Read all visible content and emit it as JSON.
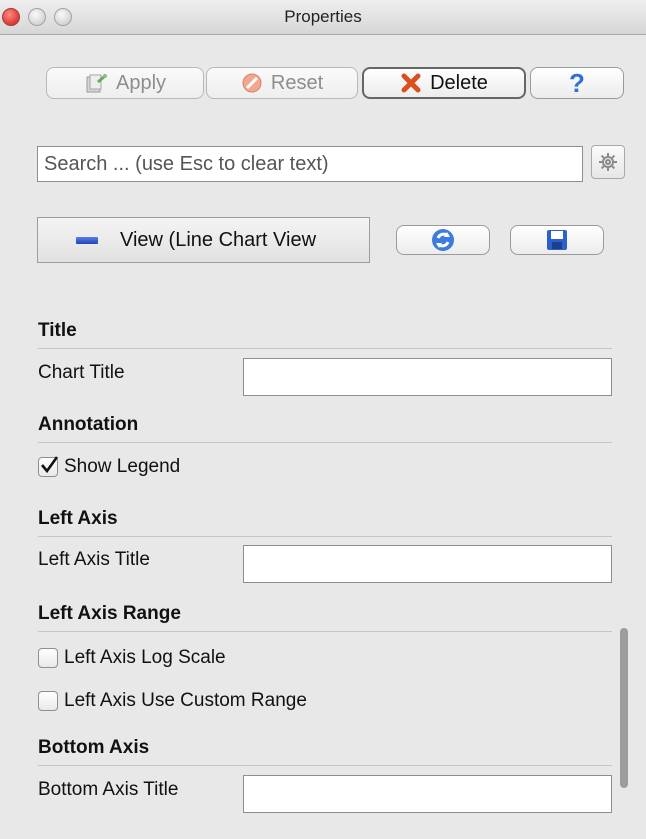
{
  "window": {
    "title": "Properties"
  },
  "toolbar": {
    "apply_label": "Apply",
    "reset_label": "Reset",
    "delete_label": "Delete",
    "help_label": "?"
  },
  "search": {
    "placeholder": "Search ... (use Esc to clear text)"
  },
  "view": {
    "label": "View (Line Chart View"
  },
  "sections": {
    "title": "Title",
    "annotation": "Annotation",
    "left_axis": "Left Axis",
    "left_axis_range": "Left Axis Range",
    "bottom_axis": "Bottom Axis"
  },
  "fields": {
    "chart_title_label": "Chart Title",
    "chart_title_value": "",
    "left_axis_title_label": "Left Axis Title",
    "left_axis_title_value": "",
    "bottom_axis_title_label": "Bottom Axis Title",
    "bottom_axis_title_value": ""
  },
  "checkboxes": {
    "show_legend": {
      "label": "Show Legend",
      "checked": true
    },
    "left_axis_log_scale": {
      "label": "Left Axis Log Scale",
      "checked": false
    },
    "left_axis_custom_range": {
      "label": "Left Axis Use Custom Range",
      "checked": false
    }
  },
  "icons": {
    "apply": "apply-icon",
    "reset": "reset-icon",
    "delete": "delete-icon",
    "help": "help-icon",
    "gear": "gear-icon",
    "refresh": "refresh-icon",
    "save": "save-icon"
  },
  "colors": {
    "window_bg": "#e8e8e8",
    "delete_x": "#d9501f",
    "help_blue": "#2f6fd6"
  }
}
